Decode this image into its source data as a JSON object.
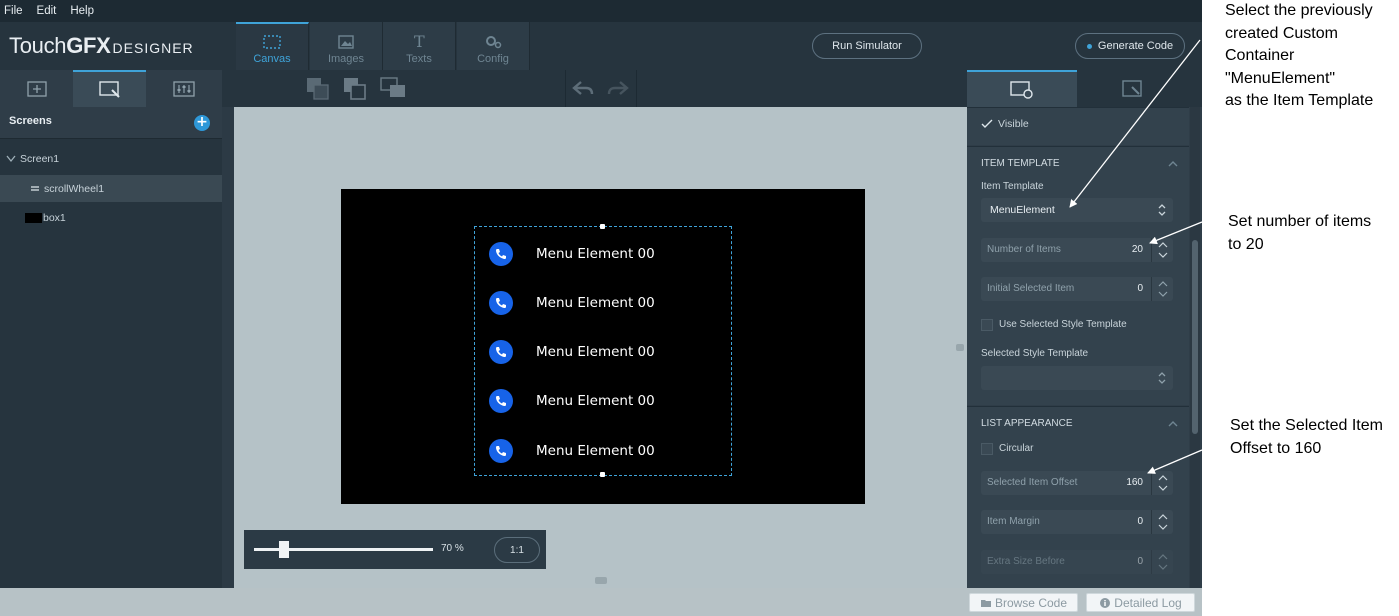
{
  "menubar": {
    "file": "File",
    "edit": "Edit",
    "help": "Help"
  },
  "logo": {
    "touch": "Touch",
    "gfx": "GFX",
    "designer": "DESIGNER"
  },
  "tabs": [
    {
      "label": "Canvas",
      "icon": "canvas-icon",
      "active": true
    },
    {
      "label": "Images",
      "icon": "images-icon",
      "active": false
    },
    {
      "label": "Texts",
      "icon": "texts-icon",
      "active": false
    },
    {
      "label": "Config",
      "icon": "config-icon",
      "active": false
    }
  ],
  "header": {
    "run_simulator": "Run Simulator",
    "generate_code": "Generate Code"
  },
  "left": {
    "screens_title": "Screens",
    "tree": {
      "screen": "Screen1",
      "scroll_wheel": "scrollWheel1",
      "box": "box1"
    }
  },
  "canvas": {
    "menu_items": [
      {
        "label": "Menu Element 00"
      },
      {
        "label": "Menu Element 00"
      },
      {
        "label": "Menu Element 00"
      },
      {
        "label": "Menu Element 00"
      },
      {
        "label": "Menu Element 00"
      }
    ],
    "zoom": {
      "percent": "70 %",
      "reset": "1:1",
      "level": 0.17
    }
  },
  "properties": {
    "visible": "Visible",
    "item_template_section": "ITEM TEMPLATE",
    "item_template_label": "Item Template",
    "item_template_value": "MenuElement",
    "number_of_items_label": "Number of Items",
    "number_of_items_value": "20",
    "initial_selected_label": "Initial Selected Item",
    "initial_selected_value": "0",
    "use_selected_style": "Use Selected Style Template",
    "selected_style_label": "Selected Style Template",
    "list_appearance_section": "LIST APPEARANCE",
    "circular": "Circular",
    "selected_offset_label": "Selected Item Offset",
    "selected_offset_value": "160",
    "item_margin_label": "Item Margin",
    "item_margin_value": "0",
    "extra_size_label": "Extra Size Before",
    "extra_size_value": "0"
  },
  "bottom": {
    "browse_code": "Browse Code",
    "detailed_log": "Detailed Log"
  },
  "annotations": {
    "template": [
      "Select the previously",
      "created Custom",
      "Container",
      "\"MenuElement\"",
      "as the Item Template"
    ],
    "items": [
      "Set number of items",
      "to 20"
    ],
    "offset": [
      "Set the Selected Item",
      "Offset to 160"
    ]
  },
  "colors": {
    "accent": "#3fa3d8",
    "phone_icon": "#1763e8"
  }
}
